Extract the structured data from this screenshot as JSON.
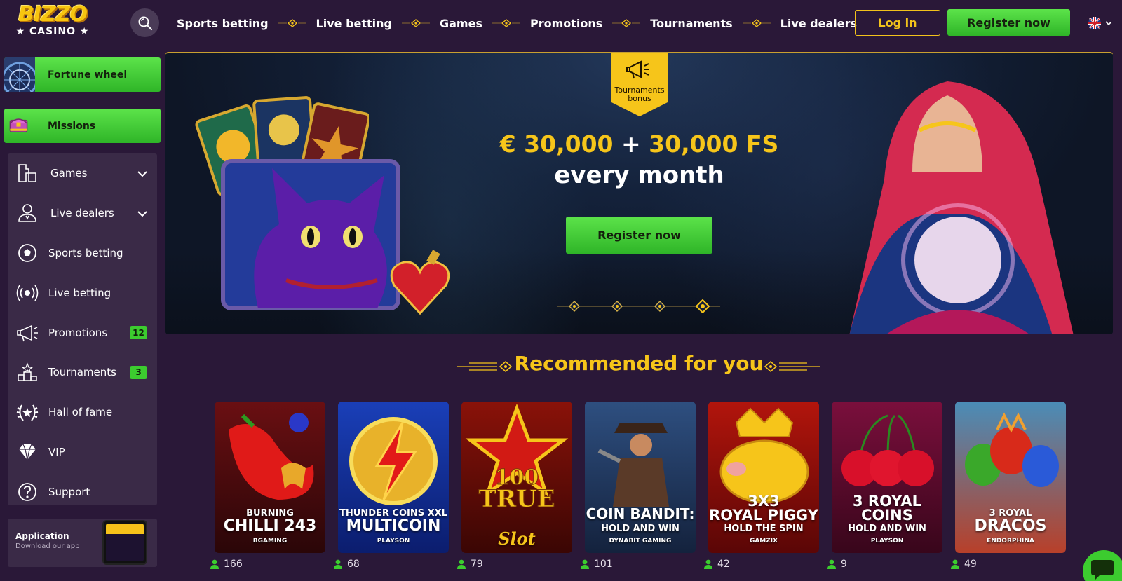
{
  "header": {
    "logo_main": "BIZZO",
    "logo_sub": "★ CASINO ★",
    "nav": [
      "Sports betting",
      "Live betting",
      "Games",
      "Promotions",
      "Tournaments",
      "Live dealers"
    ],
    "login_label": "Log in",
    "register_label": "Register now",
    "language_icon": "uk-flag-icon"
  },
  "sidebar": {
    "fortune_wheel": "Fortune wheel",
    "missions": "Missions",
    "items": [
      {
        "label": "Games",
        "icon": "puzzle-icon",
        "expandable": true
      },
      {
        "label": "Live dealers",
        "icon": "dealer-icon",
        "expandable": true
      },
      {
        "label": "Sports betting",
        "icon": "soccer-ball-icon"
      },
      {
        "label": "Live betting",
        "icon": "broadcast-icon"
      },
      {
        "label": "Promotions",
        "icon": "megaphone-icon",
        "badge": "12"
      },
      {
        "label": "Tournaments",
        "icon": "podium-icon",
        "badge": "3"
      },
      {
        "label": "Hall of fame",
        "icon": "laurel-icon"
      },
      {
        "label": "VIP",
        "icon": "diamond-icon"
      },
      {
        "label": "Support",
        "icon": "question-icon"
      }
    ],
    "app": {
      "title": "Application",
      "subtitle": "Download our app!"
    }
  },
  "banner": {
    "tag": "Tournaments bonus",
    "amount_a": "€ 30,000",
    "plus": " + ",
    "amount_b": "30,000 FS",
    "line2": "every month",
    "button": "Register now",
    "slides": 4,
    "active_slide": 4
  },
  "recommended": {
    "title": "Recommended for you",
    "games": [
      {
        "name_small": "BURNING",
        "name_big": "CHILLI 243",
        "provider": "BGAMING",
        "players": "166",
        "colors": [
          "#6a0f12",
          "#2a0608"
        ]
      },
      {
        "name_small": "THUNDER COINS XXL",
        "name_big": "MULTICOIN",
        "provider": "PLAYSON",
        "players": "68",
        "colors": [
          "#1a3fb8",
          "#0b1d6e"
        ]
      },
      {
        "name_small": "",
        "name_big": "100 TRUE Slot",
        "provider": "",
        "players": "79",
        "colors": [
          "#8a1209",
          "#3a0604"
        ]
      },
      {
        "name_small": "COIN BANDIT:",
        "name_big": "HOLD AND WIN",
        "provider": "DYNABIT GAMING",
        "players": "101",
        "colors": [
          "#2e4f80",
          "#14223d"
        ]
      },
      {
        "name_small": "3X3",
        "name_big": "ROYAL PIGGY",
        "provider": "GAMZIX",
        "players": "42",
        "extra": "HOLD THE SPIN",
        "colors": [
          "#b2150c",
          "#5a0606"
        ]
      },
      {
        "name_small": "3 ROYAL",
        "name_big": "COINS",
        "provider": "PLAYSON",
        "players": "9",
        "extra": "HOLD AND WIN",
        "colors": [
          "#7a0f3c",
          "#38061b"
        ]
      },
      {
        "name_small": "3 ROYAL",
        "name_big": "DRACOS",
        "provider": "ENDORPHINA",
        "players": "49",
        "colors": [
          "#4a8db8",
          "#b8402a"
        ]
      }
    ]
  }
}
